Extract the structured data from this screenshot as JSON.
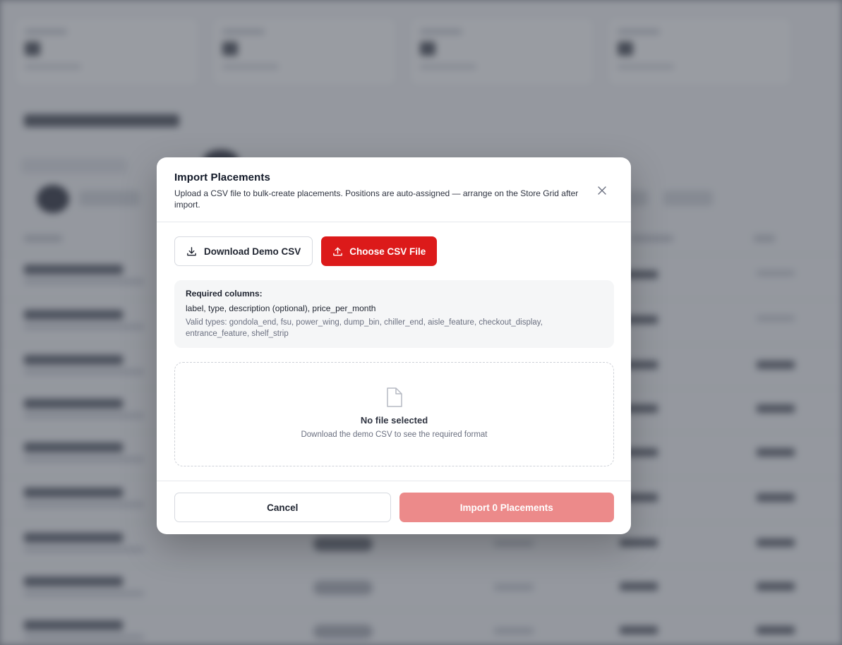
{
  "modal": {
    "title": "Import Placements",
    "subtitle": "Upload a CSV file to bulk-create placements. Positions are auto-assigned — arrange on the Store Grid after import.",
    "close_icon": "close-icon"
  },
  "actions": {
    "download_label": "Download Demo CSV",
    "download_icon": "download-icon",
    "choose_label": "Choose CSV File",
    "choose_icon": "upload-icon"
  },
  "requirements": {
    "title": "Required columns:",
    "columns": "label, type, description (optional), price_per_month",
    "valid_types": "Valid types: gondola_end, fsu, power_wing, dump_bin, chiller_end, aisle_feature, checkout_display, entrance_feature, shelf_strip"
  },
  "dropzone": {
    "icon": "file-icon",
    "title": "No file selected",
    "subtitle": "Download the demo CSV to see the required format"
  },
  "footer": {
    "cancel_label": "Cancel",
    "import_label": "Import 0 Placements"
  },
  "colors": {
    "primary": "#dc1a1a",
    "primary_disabled": "#ec8a8a"
  }
}
